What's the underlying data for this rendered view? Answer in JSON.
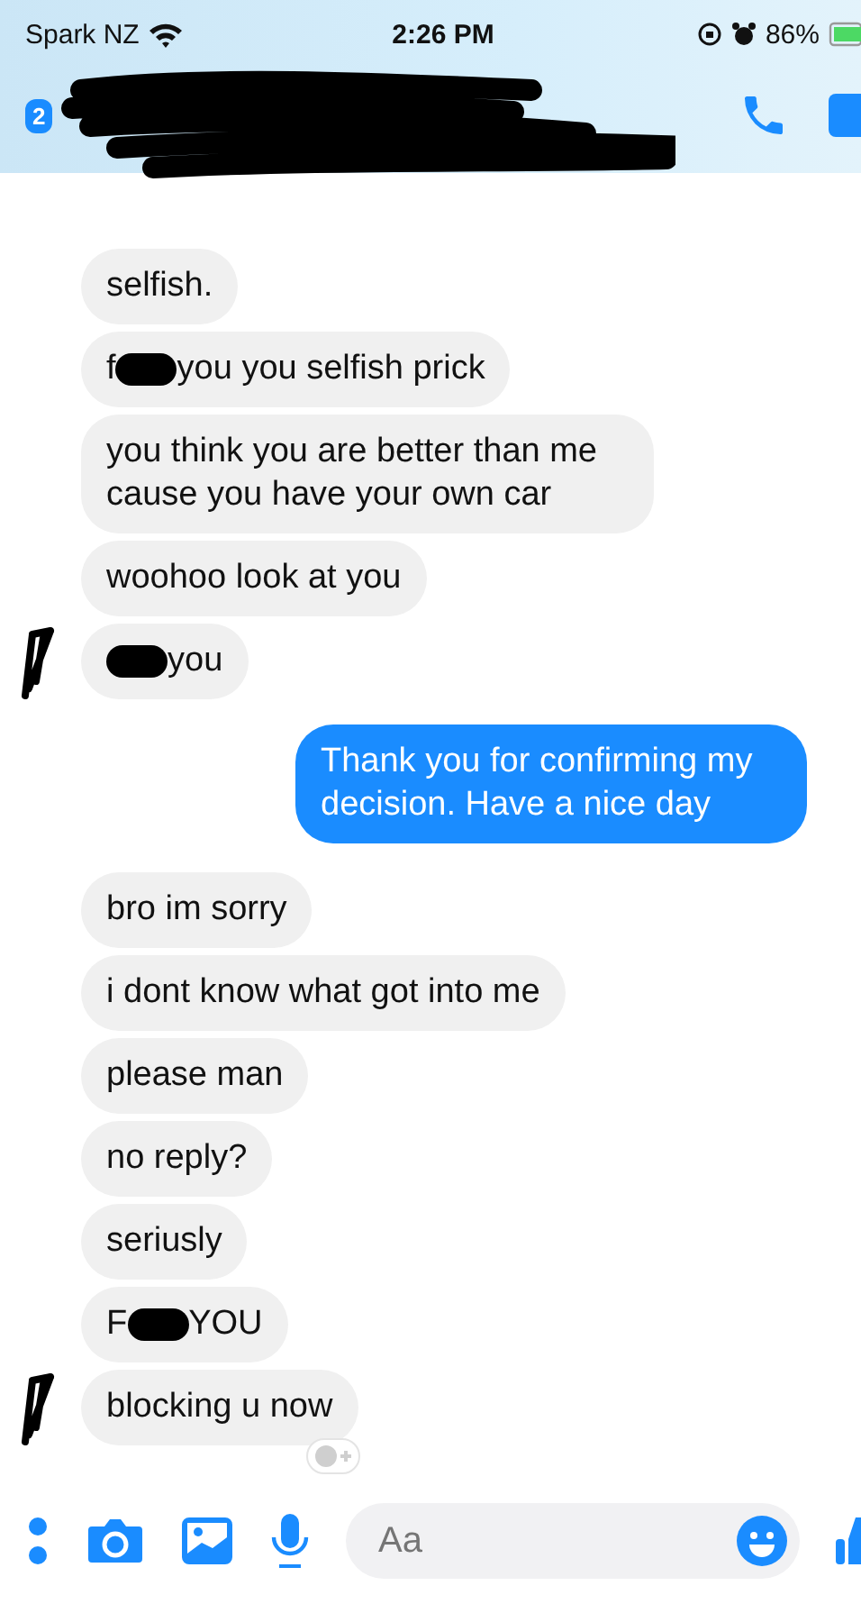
{
  "status_bar": {
    "carrier": "Spark NZ",
    "time": "2:26 PM",
    "battery": "86%"
  },
  "header": {
    "unread_badge": "2"
  },
  "messages": [
    {
      "kind": "received",
      "avatar": false,
      "parts": [
        {
          "kind": "text",
          "text": "selfish."
        }
      ]
    },
    {
      "kind": "received",
      "avatar": false,
      "parts": [
        {
          "kind": "text",
          "text": "f"
        },
        {
          "kind": "redaction"
        },
        {
          "kind": "text",
          "text": "you you selfish prick"
        }
      ]
    },
    {
      "kind": "received",
      "avatar": false,
      "parts": [
        {
          "kind": "text",
          "text": "you think you are better than me cause you have your own car"
        }
      ]
    },
    {
      "kind": "received",
      "avatar": false,
      "parts": [
        {
          "kind": "text",
          "text": "woohoo look at you"
        }
      ]
    },
    {
      "kind": "received",
      "avatar": true,
      "parts": [
        {
          "kind": "redaction"
        },
        {
          "kind": "text",
          "text": "you"
        }
      ]
    },
    {
      "kind": "sent",
      "parts": [
        {
          "kind": "text",
          "text": "Thank you for confirming my decision. Have a nice day"
        }
      ]
    },
    {
      "kind": "received",
      "avatar": false,
      "parts": [
        {
          "kind": "text",
          "text": "bro im sorry"
        }
      ]
    },
    {
      "kind": "received",
      "avatar": false,
      "parts": [
        {
          "kind": "text",
          "text": "i dont know what got into me"
        }
      ]
    },
    {
      "kind": "received",
      "avatar": false,
      "parts": [
        {
          "kind": "text",
          "text": "please man"
        }
      ]
    },
    {
      "kind": "received",
      "avatar": false,
      "parts": [
        {
          "kind": "text",
          "text": "no reply?"
        }
      ]
    },
    {
      "kind": "received",
      "avatar": false,
      "parts": [
        {
          "kind": "text",
          "text": "seriusly"
        }
      ]
    },
    {
      "kind": "received",
      "avatar": false,
      "parts": [
        {
          "kind": "text",
          "text": "F"
        },
        {
          "kind": "redaction"
        },
        {
          "kind": "text",
          "text": "YOU"
        }
      ]
    },
    {
      "kind": "received",
      "avatar": true,
      "parts": [
        {
          "kind": "text",
          "text": "blocking u now"
        }
      ]
    }
  ],
  "composer": {
    "placeholder": "Aa"
  }
}
